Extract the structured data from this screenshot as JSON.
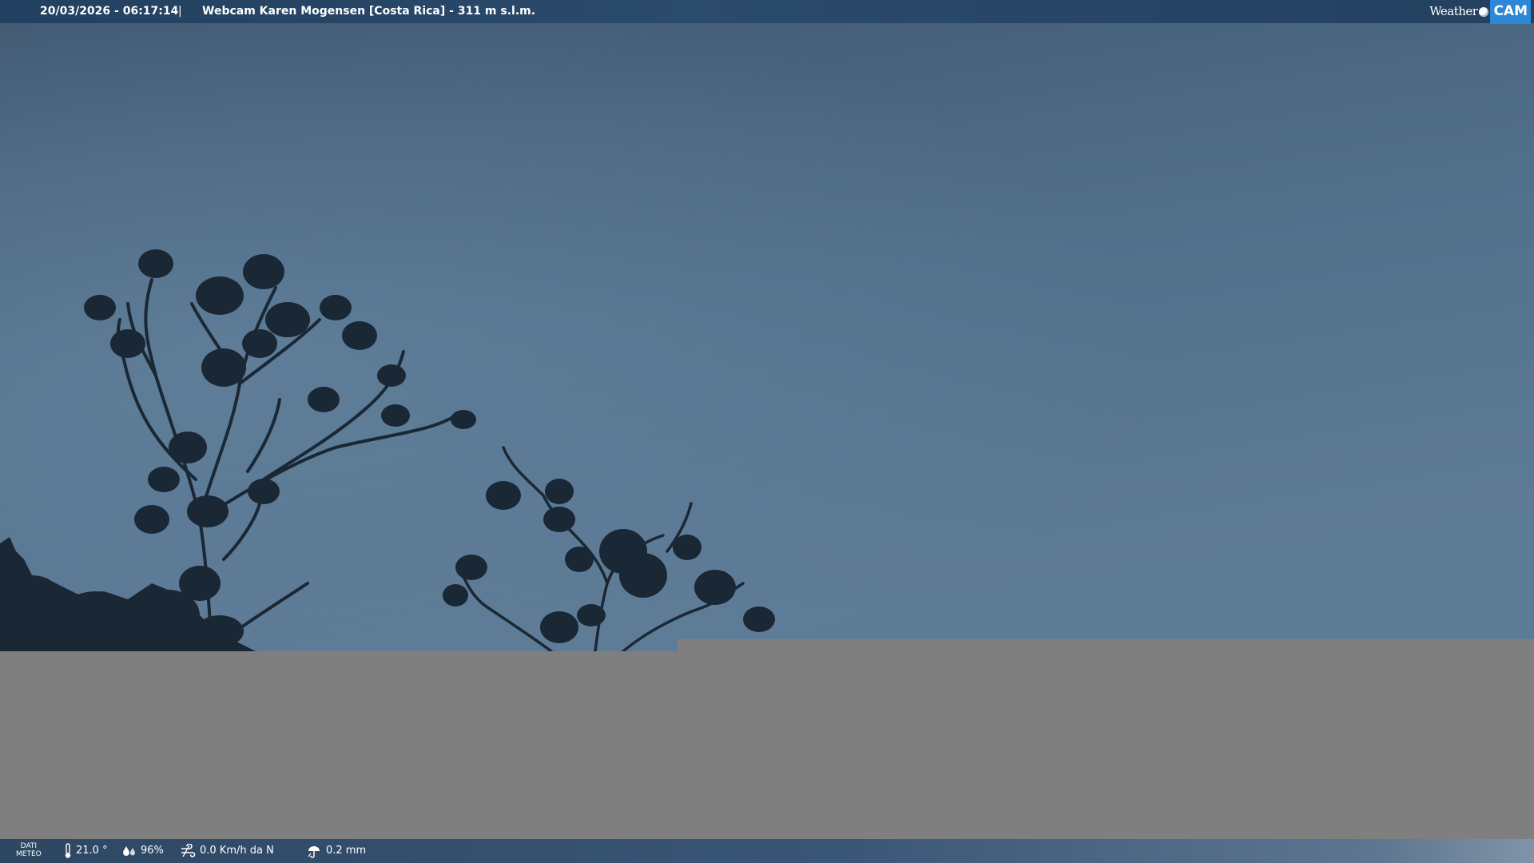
{
  "header": {
    "timestamp": "20/03/2026 - 06:17:14",
    "separator": "|",
    "camera": "Webcam Karen Mogensen [Costa Rica]  - 311 m s.l.m.",
    "logo": {
      "weather": "Weather",
      "cam": "CAM"
    }
  },
  "weather_bar": {
    "label_line1": "DATI",
    "label_line2": "METEO",
    "temperature": "21.0 °",
    "humidity": "96%",
    "wind": "0.0 Km/h da N",
    "rain": "0.2 mm"
  },
  "colors": {
    "sky_top": "#3f5770",
    "sky_bottom": "#5c7a95",
    "tree": "#1a2735",
    "ground": "#7f7f7f",
    "accent": "#2e86d6"
  }
}
